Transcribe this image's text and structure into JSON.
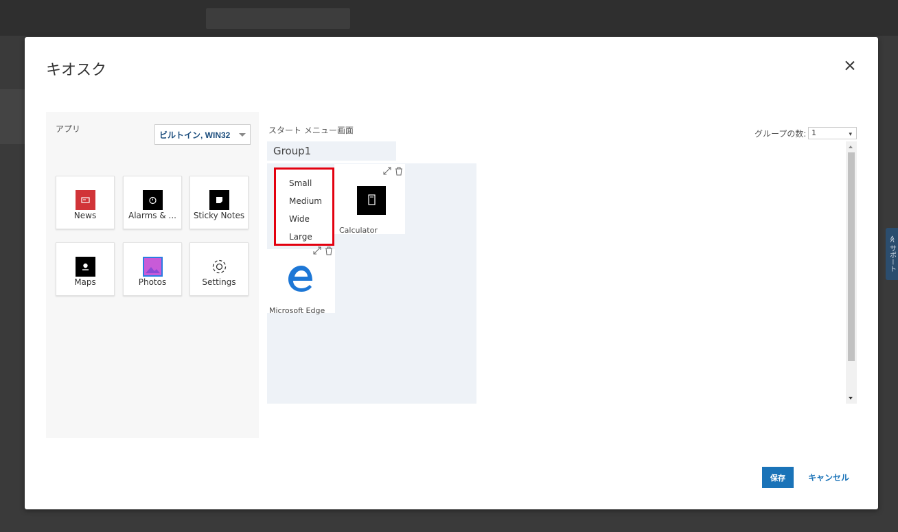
{
  "dialog": {
    "title": "キオスク"
  },
  "apps_panel": {
    "label": "アプリ",
    "filter": "ビルトイン, WIN32",
    "apps": [
      {
        "name": "News",
        "icon": "news-icon"
      },
      {
        "name": "Alarms & ...",
        "icon": "alarm-clock-icon"
      },
      {
        "name": "Sticky Notes",
        "icon": "sticky-notes-icon"
      },
      {
        "name": "Maps",
        "icon": "maps-icon"
      },
      {
        "name": "Photos",
        "icon": "photos-icon"
      },
      {
        "name": "Settings",
        "icon": "gear-icon"
      }
    ]
  },
  "start_menu": {
    "label": "スタート メニュー画面",
    "group_name": "Group1",
    "tiles": [
      {
        "name": "Calculator",
        "icon": "calculator-icon"
      },
      {
        "name": "Microsoft Edge",
        "icon": "edge-icon"
      }
    ],
    "size_menu": [
      "Small",
      "Medium",
      "Wide",
      "Large"
    ]
  },
  "group_count": {
    "label": "グループの数:",
    "value": "1"
  },
  "footer": {
    "save": "保存",
    "cancel": "キャンセル"
  },
  "support_tab": "≪ サポート",
  "colors": {
    "accent": "#1a73b8",
    "highlight": "#e3000f",
    "panel": "#f7f7f7",
    "group_bg": "#eef2f7"
  }
}
